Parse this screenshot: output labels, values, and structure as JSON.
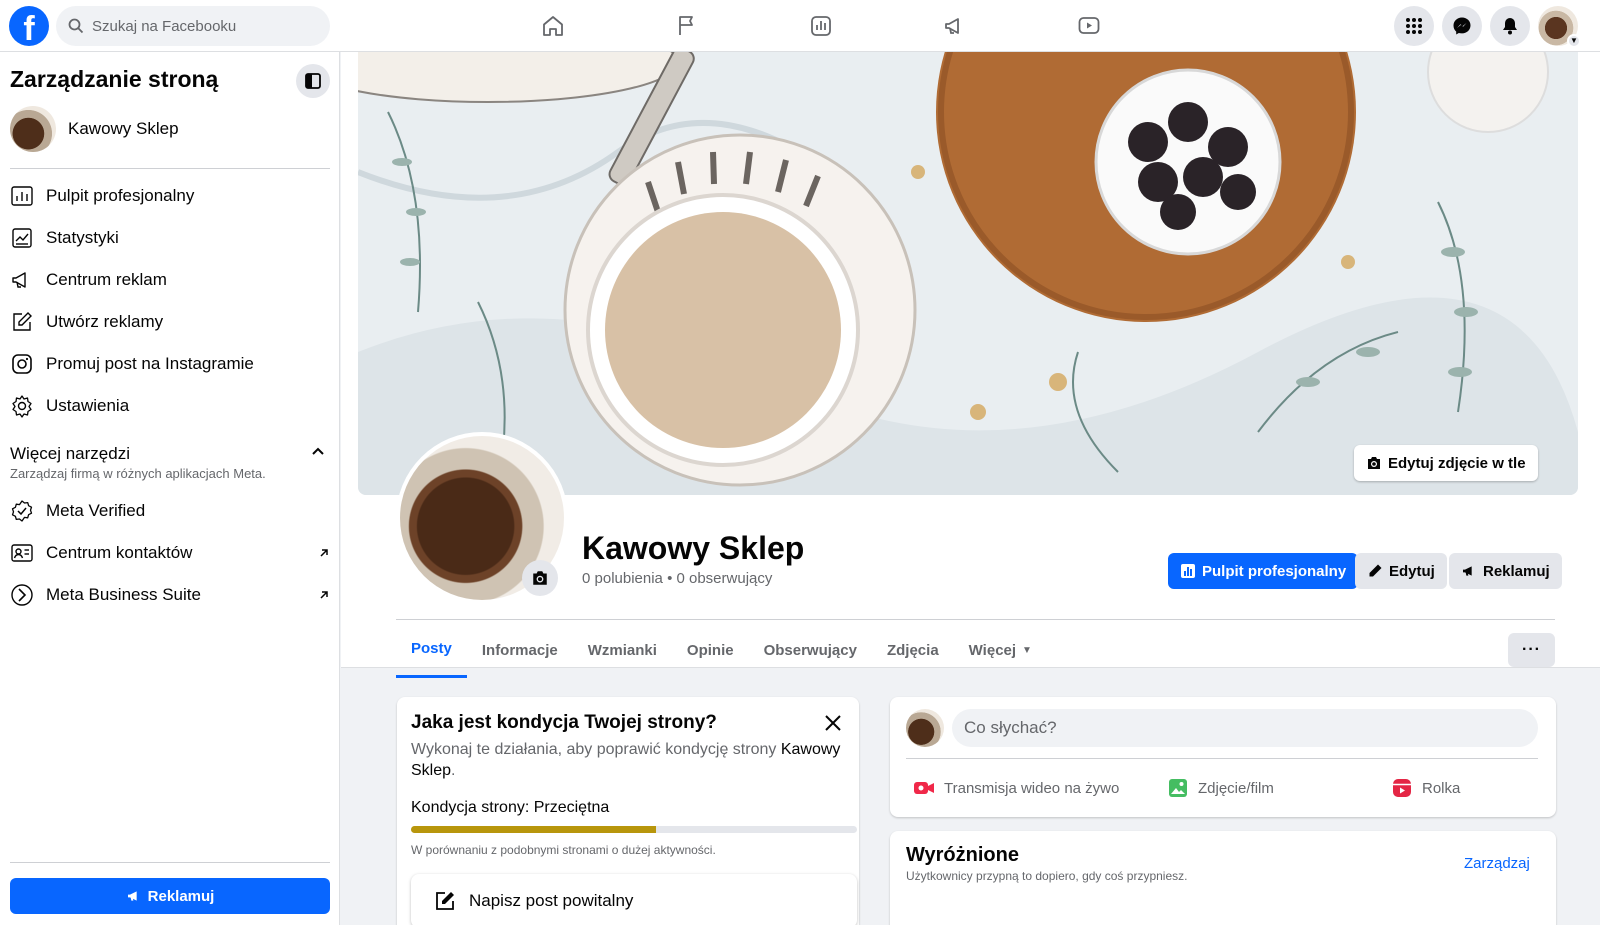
{
  "topbar": {
    "logo": "f",
    "search_placeholder": "Szukaj na Facebooku",
    "nav_icons": [
      "home-icon",
      "flag-icon",
      "insights-icon",
      "megaphone-icon",
      "video-icon"
    ]
  },
  "sidebar": {
    "title": "Zarządzanie stroną",
    "page_name": "Kawowy Sklep",
    "items": [
      {
        "label": "Pulpit profesjonalny",
        "icon": "dashboard-icon"
      },
      {
        "label": "Statystyki",
        "icon": "stats-icon"
      },
      {
        "label": "Centrum reklam",
        "icon": "megaphone-icon"
      },
      {
        "label": "Utwórz reklamy",
        "icon": "edit-icon"
      },
      {
        "label": "Promuj post na Instagramie",
        "icon": "instagram-icon"
      },
      {
        "label": "Ustawienia",
        "icon": "gear-icon"
      }
    ],
    "more_tools_title": "Więcej narzędzi",
    "more_tools_desc": "Zarządzaj firmą w różnych aplikacjach Meta.",
    "tools": [
      {
        "label": "Meta Verified",
        "icon": "verified-icon"
      },
      {
        "label": "Centrum kontaktów",
        "icon": "contacts-icon"
      },
      {
        "label": "Meta Business Suite",
        "icon": "business-suite-icon"
      }
    ],
    "ad_button": "Reklamuj"
  },
  "profile": {
    "cover_button": "Edytuj zdjęcie w tle",
    "name": "Kawowy Sklep",
    "stats": "0 polubienia • 0 obserwujący",
    "buttons": {
      "dashboard": "Pulpit profesjonalny",
      "edit": "Edytuj",
      "advertise": "Reklamuj"
    },
    "tabs": [
      "Posty",
      "Informacje",
      "Wzmianki",
      "Opinie",
      "Obserwujący",
      "Zdjęcia",
      "Więcej"
    ],
    "more_button": "···"
  },
  "health": {
    "title": "Jaka jest kondycja Twojej strony?",
    "desc_prefix": "Wykonaj te działania, aby poprawić kondycję strony ",
    "desc_page": "Kawowy Sklep",
    "desc_suffix": ".",
    "status": "Kondycja strony: Przeciętna",
    "progress": 0.55,
    "progress_color": "#b8960c",
    "note": "W porównaniu z podobnymi stronami o dużej aktywności.",
    "welcome_post": "Napisz post powitalny"
  },
  "composer": {
    "placeholder": "Co słychać?",
    "actions": [
      "Transmisja wideo na żywo",
      "Zdjęcie/film",
      "Rolka"
    ]
  },
  "featured": {
    "title": "Wyróżnione",
    "desc": "Użytkownicy przypną to dopiero, gdy coś przypniesz.",
    "manage": "Zarządzaj"
  },
  "colors": {
    "accent": "#0866ff",
    "live_red": "#f02849",
    "photo_green": "#45bd62",
    "reel_pink": "#e42645"
  }
}
